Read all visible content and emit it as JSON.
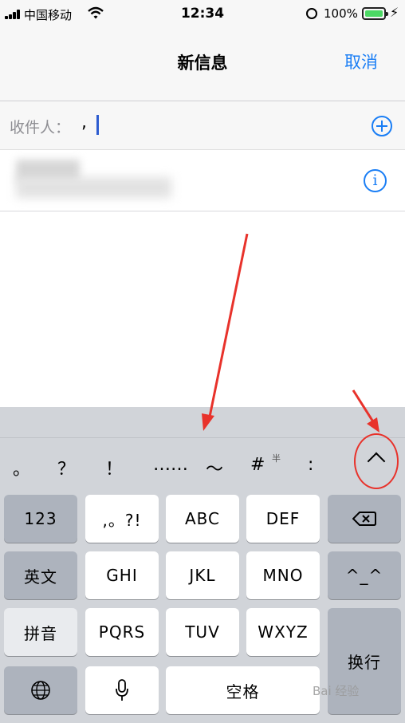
{
  "status_bar": {
    "carrier": "中国移动",
    "time": "12:34",
    "battery_percent": "100%"
  },
  "nav": {
    "title": "新信息",
    "cancel": "取消"
  },
  "recipient": {
    "label": "收件人：",
    "typed_text": ","
  },
  "candidate_bar": {
    "items": [
      "。",
      "？",
      "！",
      "……",
      "～",
      "#",
      ":"
    ],
    "half_width_label": "半"
  },
  "keyboard": {
    "rows": [
      [
        "123",
        ",。?!",
        "ABC",
        "DEF",
        "delete"
      ],
      [
        "英文",
        "GHI",
        "JKL",
        "MNO",
        "^^"
      ],
      [
        "拼音",
        "PQRS",
        "TUV",
        "WXYZ",
        "换行"
      ],
      [
        "globe",
        "mic",
        "空格"
      ]
    ],
    "labels": {
      "k123": "123",
      "punct": ",。?!",
      "abc": "ABC",
      "def": "DEF",
      "english": "英文",
      "ghi": "GHI",
      "jkl": "JKL",
      "mno": "MNO",
      "emoticon": "^_^",
      "pinyin": "拼音",
      "pqrs": "PQRS",
      "tuv": "TUV",
      "wxyz": "WXYZ",
      "return": "换行",
      "space": "空格"
    }
  },
  "icons": {
    "add_contact": "plus-circle-icon",
    "contact_info": "info-icon",
    "expand": "chevron-up-icon",
    "delete": "backspace-icon",
    "globe": "globe-icon",
    "microphone": "microphone-icon"
  },
  "watermark": "Bai 经验",
  "colors": {
    "accent": "#1a7ef5",
    "annotation": "#e8322b",
    "battery": "#4cd964"
  }
}
